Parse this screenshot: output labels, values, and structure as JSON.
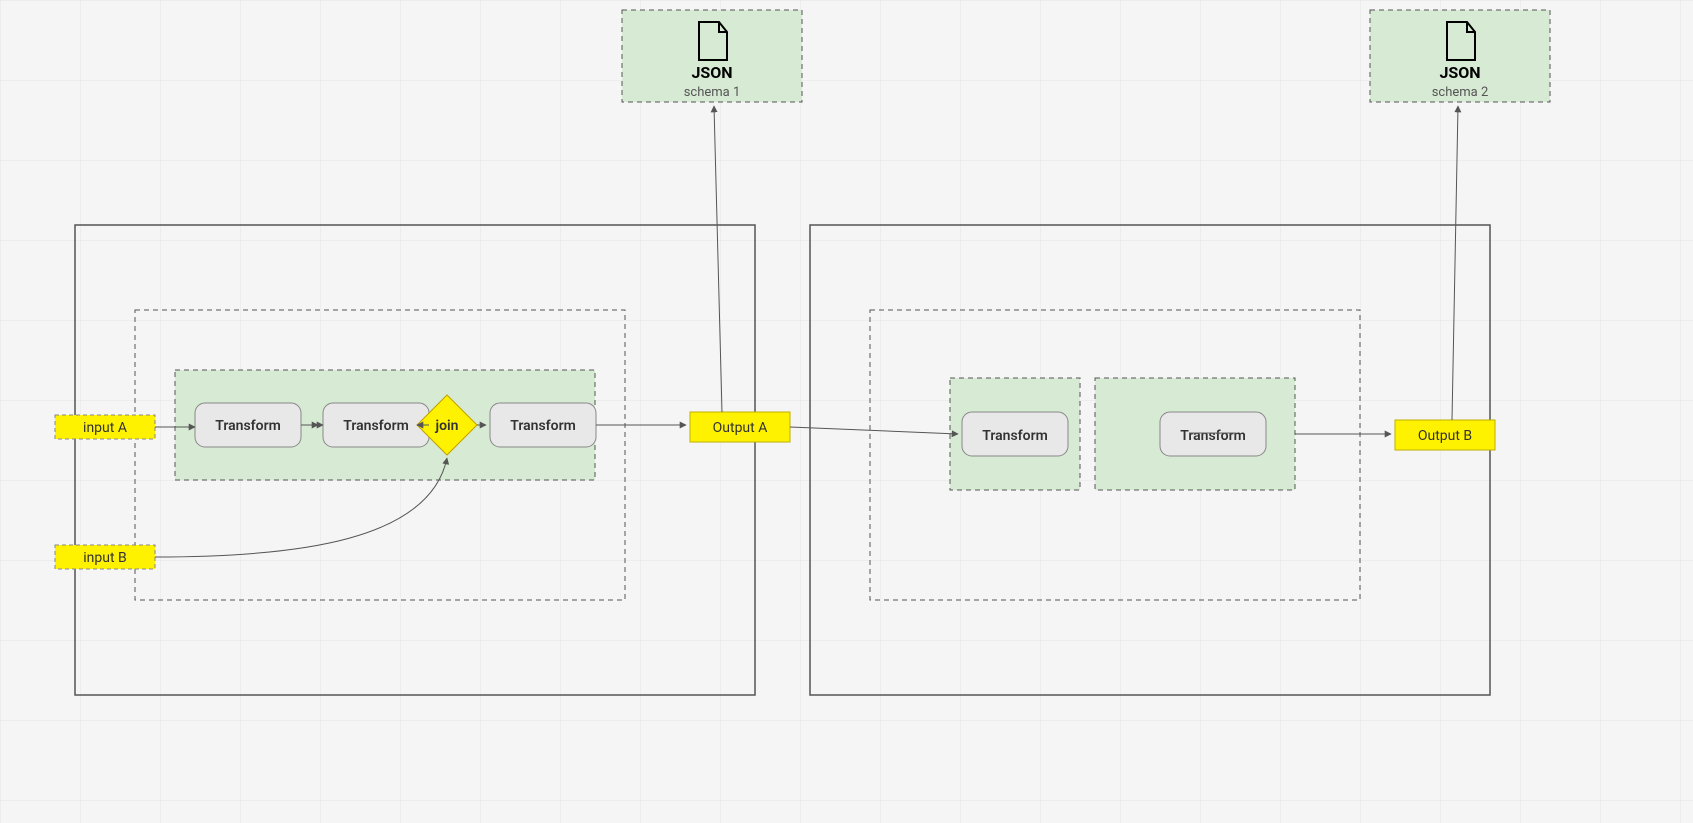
{
  "schema1": {
    "icon_label": "JSON",
    "caption": "schema 1"
  },
  "schema2": {
    "icon_label": "JSON",
    "caption": "schema 2"
  },
  "inputs": {
    "a": "input A",
    "b": "input B"
  },
  "outputs": {
    "a": "Output A",
    "b": "Output B"
  },
  "pipeline1": {
    "t1": "Transform",
    "t2": "Transform",
    "join": "join",
    "t3": "Transform"
  },
  "pipeline2": {
    "t1": "Transform",
    "t2": "Transform"
  }
}
